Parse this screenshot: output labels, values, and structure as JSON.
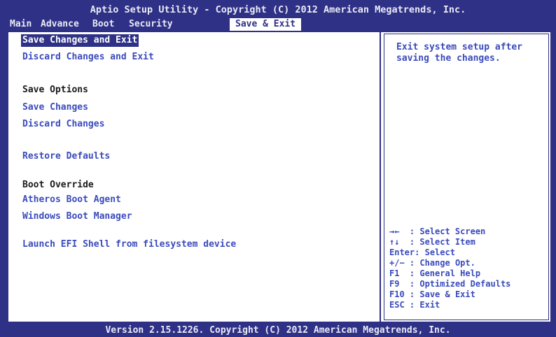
{
  "header": {
    "title": "Aptio Setup Utility - Copyright (C) 2012 American Megatrends, Inc.",
    "tabs": [
      {
        "label": "Main"
      },
      {
        "label": "Advance"
      },
      {
        "label": "Boot"
      },
      {
        "label": "Security"
      },
      {
        "label": "Save & Exit"
      }
    ],
    "active_tab": "Save & Exit"
  },
  "menu": {
    "save_changes_and_exit": "Save Changes and Exit",
    "discard_changes_and_exit": "Discard Changes and Exit",
    "save_options_heading": "Save Options",
    "save_changes": "Save Changes",
    "discard_changes": "Discard Changes",
    "restore_defaults": "Restore Defaults",
    "boot_override_heading": "Boot Override",
    "atheros_boot_agent": "Atheros Boot Agent",
    "windows_boot_manager": "Windows Boot Manager",
    "launch_efi_shell": "Launch EFI Shell from filesystem device",
    "selected_item": "Save Changes and Exit"
  },
  "help": {
    "description": "Exit system setup after saving the changes."
  },
  "keys": [
    {
      "key": "→←",
      "action": ": Select Screen"
    },
    {
      "key": "↑↓",
      "action": ": Select Item"
    },
    {
      "key": "Enter:",
      "action": "Select"
    },
    {
      "key": "+/−",
      "action": ": Change Opt."
    },
    {
      "key": "F1",
      "action": ": General Help"
    },
    {
      "key": "F9",
      "action": ": Optimized Defaults"
    },
    {
      "key": "F10",
      "action": ": Save & Exit"
    },
    {
      "key": "ESC",
      "action": ": Exit"
    }
  ],
  "footer": {
    "text": "Version 2.15.1226. Copyright (C) 2012 American Megatrends, Inc."
  },
  "colors": {
    "bios_blue": "#2e3186",
    "item_blue": "#3a4bbd",
    "background_white": "#ffffff"
  }
}
